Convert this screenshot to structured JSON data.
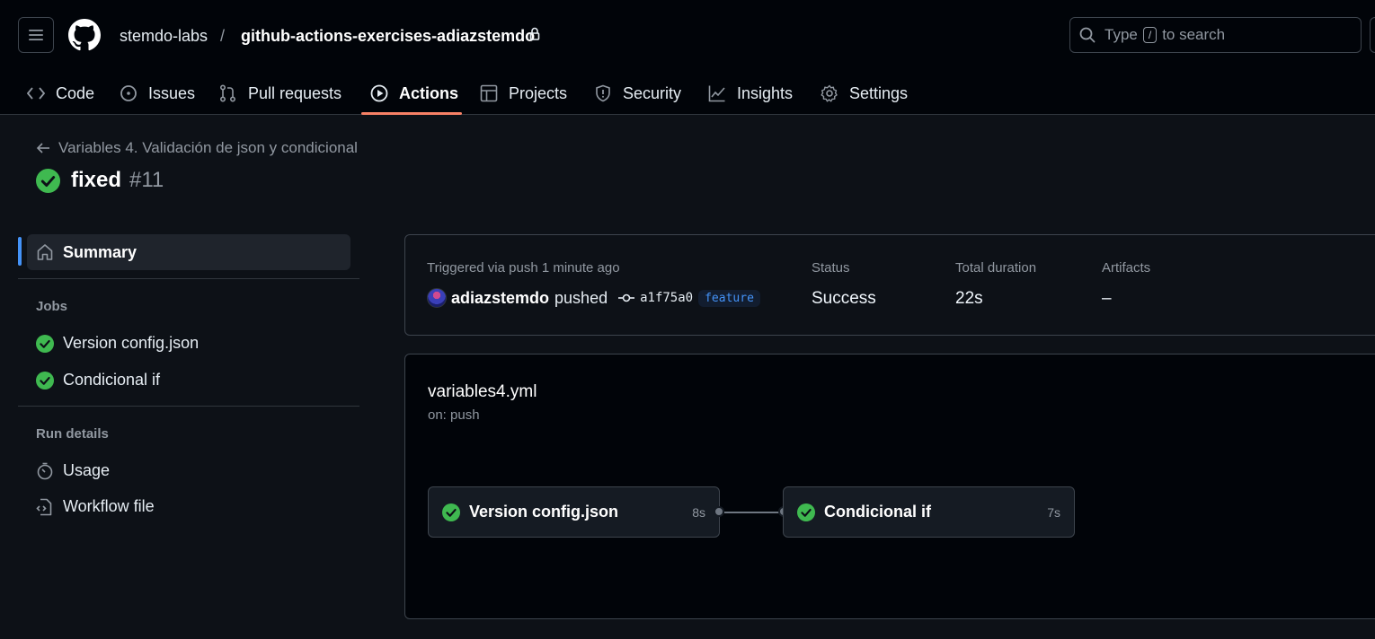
{
  "header": {
    "owner": "stemdo-labs",
    "separator": "/",
    "repo": "github-actions-exercises-adiazstemdo",
    "search": {
      "prefix": "Type",
      "key": "/",
      "suffix": "to search"
    }
  },
  "tabs": [
    {
      "label": "Code",
      "icon": "code-icon"
    },
    {
      "label": "Issues",
      "icon": "issue-icon"
    },
    {
      "label": "Pull requests",
      "icon": "pull-request-icon"
    },
    {
      "label": "Actions",
      "icon": "play-icon",
      "active": true
    },
    {
      "label": "Projects",
      "icon": "table-icon"
    },
    {
      "label": "Security",
      "icon": "shield-icon"
    },
    {
      "label": "Insights",
      "icon": "graph-icon"
    },
    {
      "label": "Settings",
      "icon": "gear-icon"
    }
  ],
  "run": {
    "workflow_link": "Variables 4. Validación de json y condicional",
    "title": "fixed",
    "number": "#11"
  },
  "sidebar": {
    "summary_label": "Summary",
    "jobs_heading": "Jobs",
    "jobs": [
      "Version config.json",
      "Condicional if"
    ],
    "run_details_heading": "Run details",
    "details": [
      {
        "label": "Usage",
        "icon": "stopwatch-icon"
      },
      {
        "label": "Workflow file",
        "icon": "file-code-icon"
      }
    ]
  },
  "summary": {
    "triggered_label": "Triggered via push 1 minute ago",
    "actor": "adiazstemdo",
    "action": "pushed",
    "commit_sha": "a1f75a0",
    "branch": "feature",
    "status_label": "Status",
    "status_value": "Success",
    "duration_label": "Total duration",
    "duration_value": "22s",
    "artifacts_label": "Artifacts",
    "artifacts_value": "–"
  },
  "workflow": {
    "file": "variables4.yml",
    "trigger": "on: push",
    "jobs": [
      {
        "name": "Version config.json",
        "duration": "8s"
      },
      {
        "name": "Condicional if",
        "duration": "7s"
      }
    ]
  },
  "colors": {
    "success": "#3fb950",
    "accent": "#f78166",
    "link": "#4493f8"
  }
}
